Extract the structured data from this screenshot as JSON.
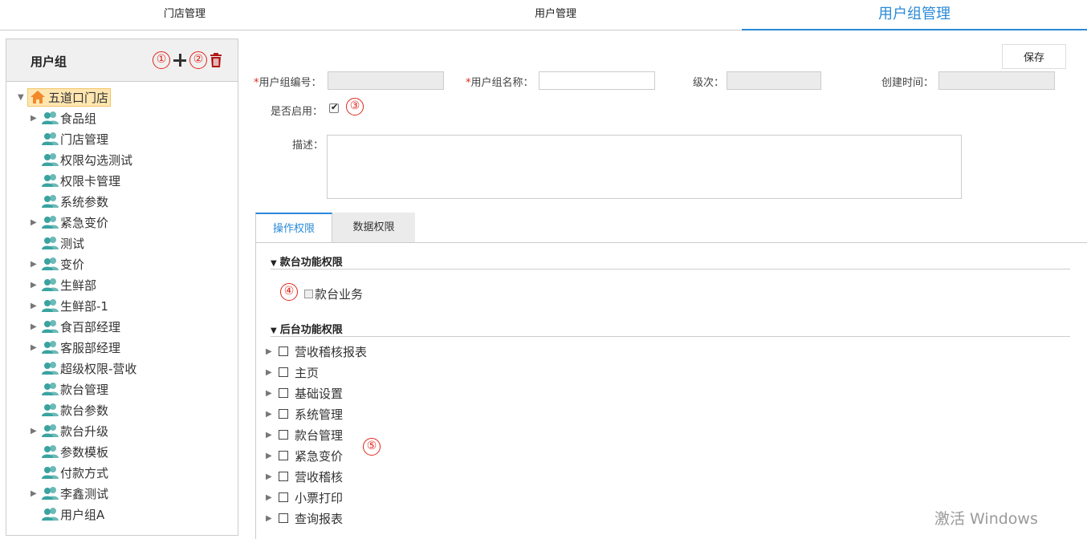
{
  "top_tabs": [
    "门店管理",
    "用户管理",
    "用户组管理"
  ],
  "sidebar": {
    "title": "用户组",
    "annotations": [
      "①",
      "②"
    ],
    "root": "五道口门店",
    "items": [
      {
        "label": "食品组",
        "expandable": true
      },
      {
        "label": "门店管理",
        "expandable": false
      },
      {
        "label": "权限勾选测试",
        "expandable": false
      },
      {
        "label": "权限卡管理",
        "expandable": false
      },
      {
        "label": "系统参数",
        "expandable": false
      },
      {
        "label": "紧急变价",
        "expandable": true
      },
      {
        "label": "测试",
        "expandable": false
      },
      {
        "label": "变价",
        "expandable": true
      },
      {
        "label": "生鲜部",
        "expandable": true
      },
      {
        "label": "生鲜部-1",
        "expandable": true
      },
      {
        "label": "食百部经理",
        "expandable": true
      },
      {
        "label": "客服部经理",
        "expandable": true
      },
      {
        "label": "超级权限-营收",
        "expandable": false
      },
      {
        "label": "款台管理",
        "expandable": false
      },
      {
        "label": "款台参数",
        "expandable": false
      },
      {
        "label": "款台升级",
        "expandable": true
      },
      {
        "label": "参数模板",
        "expandable": false
      },
      {
        "label": "付款方式",
        "expandable": false
      },
      {
        "label": "李鑫测试",
        "expandable": true
      },
      {
        "label": "用户组A",
        "expandable": false
      }
    ]
  },
  "form": {
    "save_label": "保存",
    "required_mark": "*",
    "code_label": "用户组编号：",
    "name_label": "用户组名称：",
    "level_label": "级次：",
    "created_label": "创建时间：",
    "enabled_label": "是否启用：",
    "enabled_checked": true,
    "desc_label": "描述：",
    "anno3": "③"
  },
  "perm_tabs": [
    "操作权限",
    "数据权限"
  ],
  "permissions": {
    "section1": "款台功能权限",
    "anno4": "④",
    "section1_items": [
      "款台业务"
    ],
    "section2": "后台功能权限",
    "anno5": "⑤",
    "section2_items": [
      "营收稽核报表",
      "主页",
      "基础设置",
      "系统管理",
      "款台管理",
      "紧急变价",
      "营收稽核",
      "小票打印",
      "查询报表"
    ]
  },
  "watermark": "激活 Windows",
  "colors": {
    "accent": "#2a8ad8",
    "annotation": "#e0261c",
    "user_icon": "#3aa3a0"
  }
}
